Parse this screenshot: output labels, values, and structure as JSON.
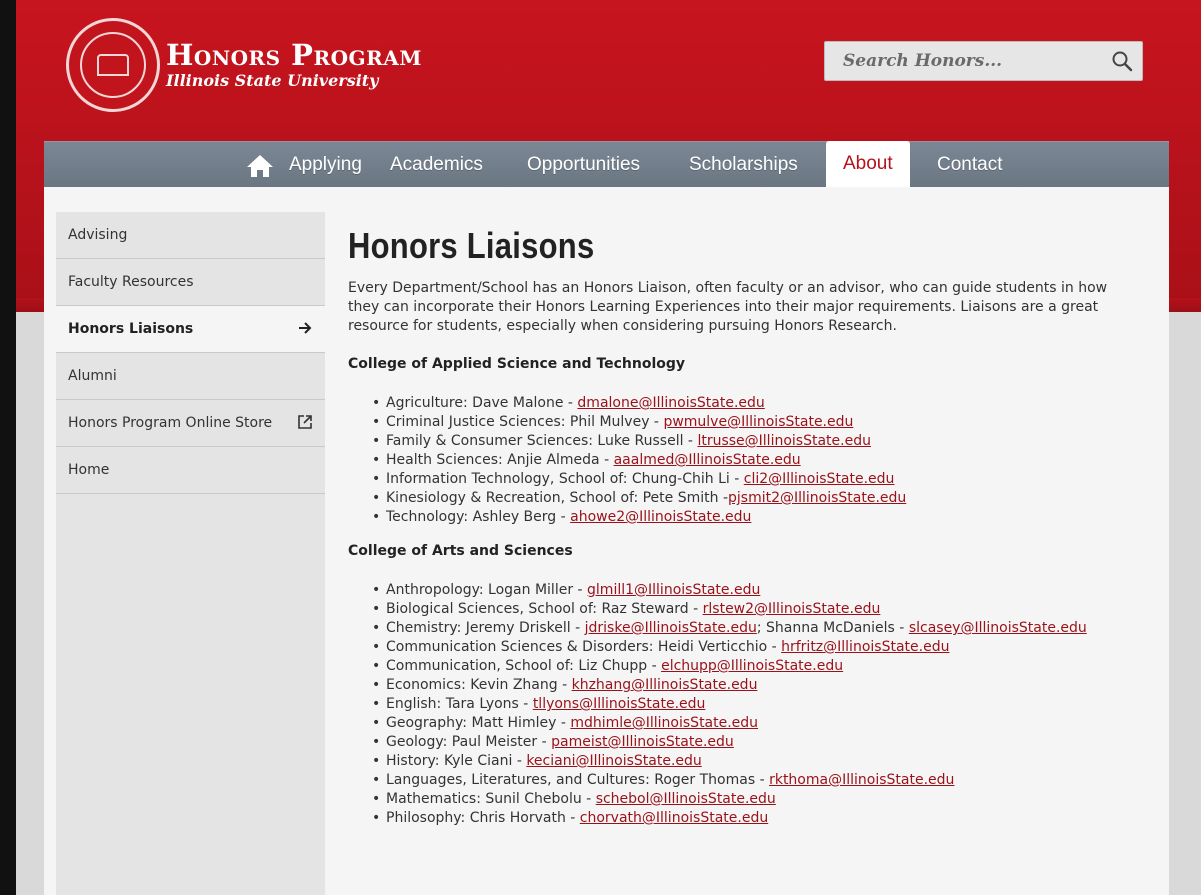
{
  "header": {
    "title": "Honors Program",
    "subtitle": "Illinois State University"
  },
  "search": {
    "placeholder": "Search Honors..."
  },
  "nav": {
    "home_icon": "home-icon",
    "items": [
      "Applying",
      "Academics",
      "Opportunities",
      "Scholarships",
      "About",
      "Contact"
    ],
    "active": "About"
  },
  "sidebar": {
    "items": [
      {
        "label": "Advising"
      },
      {
        "label": "Faculty Resources"
      },
      {
        "label": "Honors Liaisons",
        "active": true,
        "icon": "arrow-right-icon"
      },
      {
        "label": "Alumni"
      },
      {
        "label": "Honors Program Online Store",
        "icon": "external-link-icon"
      },
      {
        "label": "Home"
      }
    ]
  },
  "main": {
    "title": "Honors Liaisons",
    "intro": "Every Department/School has an Honors Liaison, often faculty or an advisor, who can guide students in how they can incorporate their Honors Learning Experiences into their major requirements. Liaisons are a great resource for students, especially when considering pursuing Honors Research.",
    "colleges": [
      {
        "name": "College of Applied Science and Technology",
        "entries": [
          {
            "text": "Agriculture: Dave Malone - ",
            "email": "dmalone@IllinoisState.edu"
          },
          {
            "text": "Criminal Justice Sciences: Phil Mulvey - ",
            "email": "pwmulve@IllinoisState.edu"
          },
          {
            "text": "Family & Consumer Sciences: Luke Russell - ",
            "email": "ltrusse@IllinoisState.edu"
          },
          {
            "text": "Health Sciences: Anjie Almeda - ",
            "email": "aaalmed@IllinoisState.edu"
          },
          {
            "text": "Information Technology, School of: Chung-Chih Li - ",
            "email": "cli2@IllinoisState.edu"
          },
          {
            "text": "Kinesiology & Recreation, School of: Pete Smith -",
            "email": "pjsmit2@IllinoisState.edu"
          },
          {
            "text": "Technology: Ashley Berg - ",
            "email": "ahowe2@IllinoisState.edu"
          }
        ]
      },
      {
        "name": "College of Arts and Sciences",
        "entries": [
          {
            "text": "Anthropology: Logan Miller - ",
            "email": "glmill1@IllinoisState.edu"
          },
          {
            "text": "Biological Sciences, School of: Raz Steward - ",
            "email": "rlstew2@IllinoisState.edu"
          },
          {
            "text": "Chemistry: Jeremy Driskell - ",
            "email": "jdriske@IllinoisState.edu",
            "text2": "; Shanna McDaniels - ",
            "email2": "slcasey@IllinoisState.edu"
          },
          {
            "text": "Communication Sciences & Disorders: Heidi Verticchio - ",
            "email": "hrfritz@IllinoisState.edu"
          },
          {
            "text": "Communication, School of: Liz Chupp - ",
            "email": "elchupp@IllinoisState.edu"
          },
          {
            "text": "Economics: Kevin Zhang - ",
            "email": "khzhang@IllinoisState.edu"
          },
          {
            "text": "English: Tara Lyons - ",
            "email": "tllyons@IllinoisState.edu"
          },
          {
            "text": "Geography: Matt Himley - ",
            "email": "mdhimle@IllinoisState.edu"
          },
          {
            "text": "Geology: Paul Meister - ",
            "email": "pameist@IllinoisState.edu"
          },
          {
            "text": "History: Kyle Ciani - ",
            "email": "keciani@IllinoisState.edu"
          },
          {
            "text": "Languages, Literatures, and Cultures: Roger Thomas - ",
            "email": "rkthoma@IllinoisState.edu"
          },
          {
            "text": "Mathematics: Sunil Chebolu - ",
            "email": "schebol@IllinoisState.edu"
          },
          {
            "text": "Philosophy: Chris Horvath - ",
            "email": "chorvath@IllinoisState.edu"
          }
        ]
      }
    ]
  },
  "colors": {
    "brand_red": "#b5121b",
    "nav_gray": "#727d8a",
    "link": "#9a1119"
  }
}
